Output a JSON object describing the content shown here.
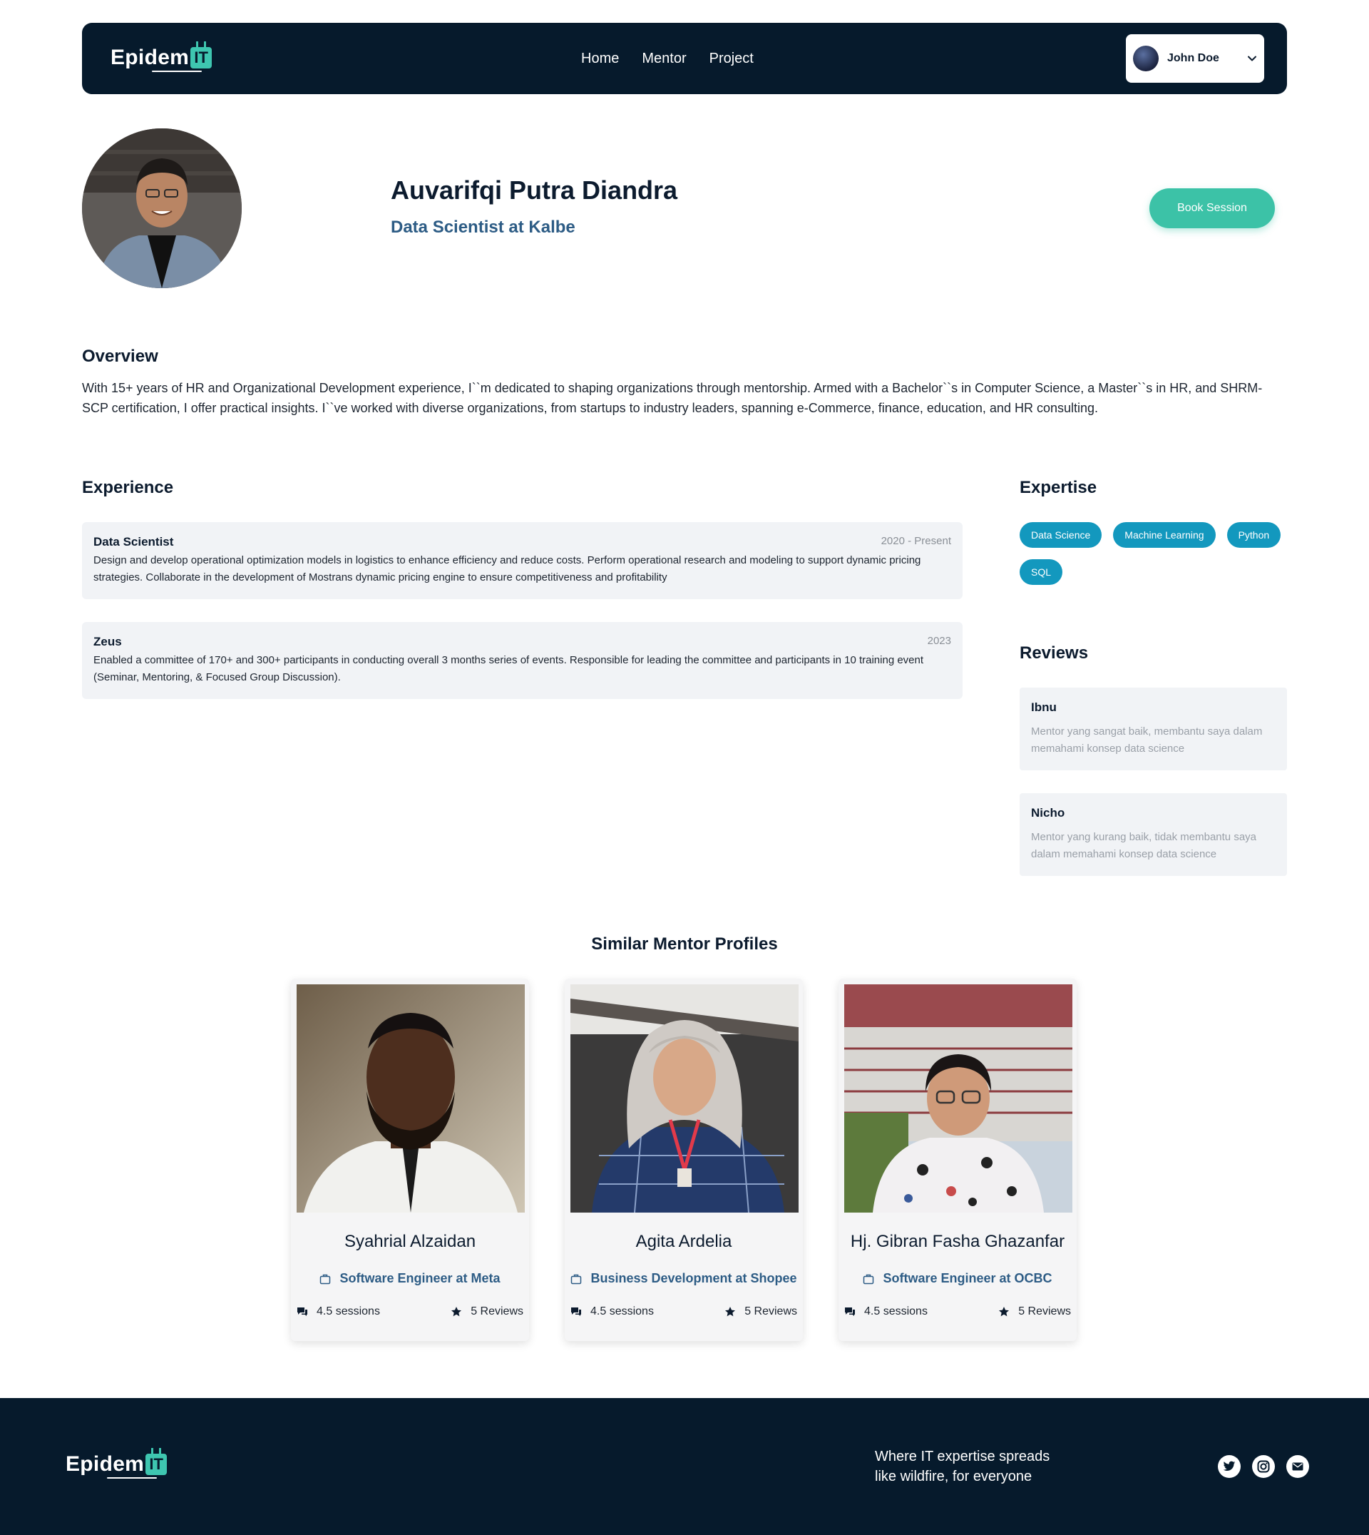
{
  "brand": {
    "logo_word": "Epidem",
    "logo_badge": "IT"
  },
  "nav": {
    "links": [
      "Home",
      "Mentor",
      "Project"
    ],
    "user": {
      "name": "John Doe",
      "menu_icon": "chevron-down-icon"
    }
  },
  "profile": {
    "name": "Auvarifqi Putra Diandra",
    "title": "Data Scientist at Kalbe",
    "book_label": "Book Session"
  },
  "overview": {
    "heading": "Overview",
    "text": "With 15+ years of HR and Organizational Development experience, I``m dedicated to shaping organizations through mentorship. Armed with a Bachelor``s in Computer Science, a Master``s in HR, and SHRM-SCP certification, I offer practical insights. I``ve worked with diverse organizations, from startups to industry leaders, spanning e-Commerce, finance, education, and HR consulting."
  },
  "experience": {
    "heading": "Experience",
    "items": [
      {
        "role": "Data Scientist",
        "period": "2020 - Present",
        "description": "Design and develop operational optimization models in logistics to enhance efficiency and reduce costs. Perform operational research and modeling to support dynamic pricing strategies. Collaborate in the development of Mostrans dynamic pricing engine to ensure competitiveness and profitability"
      },
      {
        "role": "Zeus",
        "period": "2023",
        "description": "Enabled a committee of 170+ and 300+ participants in conducting overall 3 months series of events. Responsible for leading the committee and participants in 10 training event (Seminar, Mentoring, & Focused Group Discussion)."
      }
    ]
  },
  "expertise": {
    "heading": "Expertise",
    "tags": [
      "Data Science",
      "Machine Learning",
      "Python",
      "SQL"
    ]
  },
  "reviews": {
    "heading": "Reviews",
    "items": [
      {
        "name": "Ibnu",
        "text": "Mentor yang sangat baik, membantu saya dalam memahami konsep data science"
      },
      {
        "name": "Nicho",
        "text": "Mentor yang kurang baik, tidak membantu saya dalam memahami konsep data science"
      }
    ]
  },
  "similar": {
    "heading": "Similar Mentor Profiles",
    "mentors": [
      {
        "name": "Syahrial Alzaidan",
        "role": "Software Engineer at Meta",
        "sessions": "4.5 sessions",
        "reviews": "5 Reviews"
      },
      {
        "name": "Agita Ardelia",
        "role": "Business Development at Shopee",
        "sessions": "4.5 sessions",
        "reviews": "5 Reviews"
      },
      {
        "name": "Hj. Gibran Fasha Ghazanfar",
        "role": "Software Engineer at OCBC",
        "sessions": "4.5 sessions",
        "reviews": "5 Reviews"
      }
    ]
  },
  "footer": {
    "tagline_line1": "Where IT expertise spreads",
    "tagline_line2": "like wildfire, for everyone",
    "social_icons": [
      "twitter-icon",
      "instagram-icon",
      "mail-icon"
    ]
  },
  "colors": {
    "navy": "#061a2c",
    "accent_teal": "#3cc2a7",
    "tag_blue": "#1398be",
    "role_blue": "#2d5c85"
  }
}
